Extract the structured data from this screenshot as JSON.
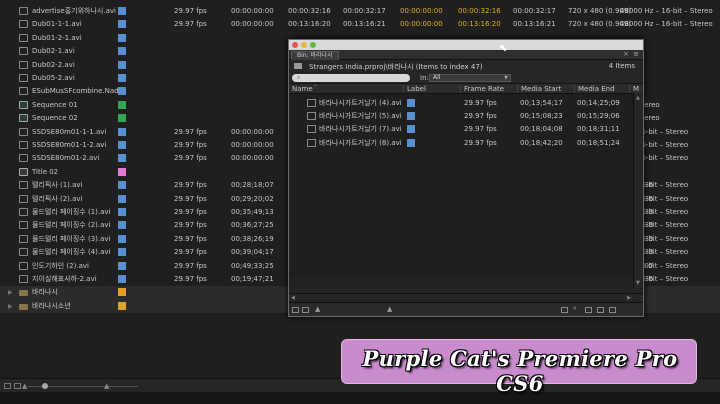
{
  "project": {
    "rows": [
      {
        "type": "clip",
        "name": "advertise홍기위하나시.avi",
        "chip": "#5a8fd0",
        "fps": "29.97 fps",
        "t1": "00:00:00:00",
        "t2": "00:00:32:16",
        "t3": "00:00:32:17",
        "t4": "00:00:00:00",
        "t5": "00:00:32:16",
        "t6": "00:00:32:17",
        "video": "720 x 480 (0.909)",
        "audio": "48000 Hz – 16-bit – Stereo"
      },
      {
        "type": "clip",
        "name": "Dub01-1-1.avi",
        "chip": "#5a8fd0",
        "fps": "29.97 fps",
        "t1": "00:00:00:00",
        "t2": "00:13:16:20",
        "t3": "00:13:16:21",
        "t4": "00:00:00:00",
        "t5": "00:13:16:20",
        "t6": "00:13:16:21",
        "video": "720 x 480 (0.909)",
        "audio": "48000 Hz – 16-bit – Stereo"
      },
      {
        "type": "clip",
        "name": "Dub01-2-1.avi",
        "chip": "#5a8fd0",
        "fps": "",
        "t1": "",
        "t2": "",
        "t3": "",
        "t4": "",
        "t5": "",
        "t6": "",
        "video": "",
        "audio": ""
      },
      {
        "type": "clip",
        "name": "Dub02-1.avi",
        "chip": "#5a8fd0",
        "fps": "",
        "t1": "",
        "t2": "",
        "t3": "",
        "t4": "",
        "t5": "",
        "t6": "",
        "video": "",
        "audio": ""
      },
      {
        "type": "clip",
        "name": "Dub02-2.avi",
        "chip": "#5a8fd0",
        "fps": "",
        "t1": "",
        "t2": "",
        "t3": "",
        "t4": "",
        "t5": "",
        "t6": "",
        "video": "",
        "audio": ""
      },
      {
        "type": "clip",
        "name": "Dub05-2.avi",
        "chip": "#5a8fd0",
        "fps": "",
        "t1": "",
        "t2": "",
        "t3": "",
        "t4": "",
        "t5": "",
        "t6": "",
        "video": "",
        "audio": ""
      },
      {
        "type": "clip",
        "name": "ESubMusSFcombine.Nade",
        "chip": "#5a8fd0",
        "fps": "",
        "t1": "",
        "t2": "",
        "t3": "",
        "t4": "",
        "t5": "",
        "t6": "",
        "video": "",
        "audio": ""
      },
      {
        "type": "seq",
        "name": "Sequence 01",
        "chip": "#2fa84f",
        "fps": "",
        "t1": "",
        "t2": "",
        "t3": "",
        "t4": "",
        "t5": "",
        "t6": "",
        "video": "",
        "audio": "Hz – Stereo"
      },
      {
        "type": "seq",
        "name": "Sequence 02",
        "chip": "#2fa84f",
        "fps": "",
        "t1": "",
        "t2": "",
        "t3": "",
        "t4": "",
        "t5": "",
        "t6": "",
        "video": "",
        "audio": "Hz – Stereo"
      },
      {
        "type": "clip",
        "name": "SSDSE80m01-1-1.avi",
        "chip": "#5a8fd0",
        "fps": "29.97 fps",
        "t1": "00:00:00:00",
        "t2": "",
        "t3": "",
        "t4": "",
        "t5": "",
        "t6": "",
        "video": "",
        "audio": "Hz – 16-bit – Stereo"
      },
      {
        "type": "clip",
        "name": "SSDSE80m01-1-2.avi",
        "chip": "#5a8fd0",
        "fps": "29.97 fps",
        "t1": "00:00:00:00",
        "t2": "",
        "t3": "",
        "t4": "",
        "t5": "",
        "t6": "",
        "video": "",
        "audio": "Hz – 16-bit – Stereo"
      },
      {
        "type": "clip",
        "name": "SSDSE80m01-2.avi",
        "chip": "#5a8fd0",
        "fps": "29.97 fps",
        "t1": "00:00:00:00",
        "t2": "",
        "t3": "",
        "t4": "",
        "t5": "",
        "t6": "",
        "video": "",
        "audio": "Hz – 16-bit – Stereo"
      },
      {
        "type": "title",
        "name": "Title 02",
        "chip": "#e07ad0",
        "fps": "",
        "t1": "",
        "t2": "",
        "t3": "",
        "t4": "",
        "t5": "",
        "t6": "",
        "video": "",
        "audio": ""
      },
      {
        "type": "clip",
        "name": "텔리픽사 (1).avi",
        "chip": "#5a8fd0",
        "fps": "29.97 fps",
        "t1": "00;28;18;07",
        "t2": "",
        "t3": "",
        "t4": "",
        "t5": "",
        "t6": "",
        "video": "",
        "audio": "Hz – 16-bit – Stereo",
        "more": "036"
      },
      {
        "type": "clip",
        "name": "텔리픽사 (2).avi",
        "chip": "#5a8fd0",
        "fps": "29.97 fps",
        "t1": "00;29;20;02",
        "t2": "",
        "t3": "",
        "t4": "",
        "t5": "",
        "t6": "",
        "video": "",
        "audio": "Hz – 16-bit – Stereo",
        "more": "036"
      },
      {
        "type": "clip",
        "name": "물드텔리 페이징수 (1).avi",
        "chip": "#5a8fd0",
        "fps": "29.97 fps",
        "t1": "00;35;49;13",
        "t2": "",
        "t3": "",
        "t4": "",
        "t5": "",
        "t6": "",
        "video": "",
        "audio": "Hz – 16-bit – Stereo",
        "more": "033"
      },
      {
        "type": "clip",
        "name": "물드텔리 페이징수 (2).avi",
        "chip": "#5a8fd0",
        "fps": "29.97 fps",
        "t1": "00;36;27;25",
        "t2": "",
        "t3": "",
        "t4": "",
        "t5": "",
        "t6": "",
        "video": "",
        "audio": "Hz – 16-bit – Stereo",
        "more": "033"
      },
      {
        "type": "clip",
        "name": "물드텔리 페이징수 (3).avi",
        "chip": "#5a8fd0",
        "fps": "29.97 fps",
        "t1": "00;38;26;19",
        "t2": "",
        "t3": "",
        "t4": "",
        "t5": "",
        "t6": "",
        "video": "",
        "audio": "Hz – 16-bit – Stereo",
        "more": "033"
      },
      {
        "type": "clip",
        "name": "물드텔리 페이징수 (4).avi",
        "chip": "#5a8fd0",
        "fps": "29.97 fps",
        "t1": "00;39;04;17",
        "t2": "",
        "t3": "",
        "t4": "",
        "t5": "",
        "t6": "",
        "video": "",
        "audio": "Hz – 16-bit – Stereo",
        "more": "033"
      },
      {
        "type": "clip",
        "name": "인도기하인 (2).avi",
        "chip": "#5a8fd0",
        "fps": "29.97 fps",
        "t1": "00;49;33;25",
        "t2": "",
        "t3": "",
        "t4": "",
        "t5": "",
        "t6": "",
        "video": "",
        "audio": "Hz – 16-bit – Stereo",
        "more": "007"
      },
      {
        "type": "clip",
        "name": "지이실해표사하-2.avi",
        "chip": "#5a8fd0",
        "fps": "29.97 fps",
        "t1": "00;19;47;21",
        "t2": "",
        "t3": "",
        "t4": "",
        "t5": "",
        "t6": "",
        "video": "",
        "audio": "Hz – 16-bit – Stereo",
        "more": "036"
      },
      {
        "type": "bin",
        "name": "바라나시",
        "chip": "#e0a030",
        "fps": "",
        "t1": "",
        "t2": "",
        "t3": "",
        "t4": "",
        "t5": "",
        "t6": "",
        "video": "",
        "audio": ""
      },
      {
        "type": "bin",
        "name": "바라나시소년",
        "chip": "#e0a030",
        "fps": "",
        "t1": "",
        "t2": "",
        "t3": "",
        "t4": "",
        "t5": "",
        "t6": "",
        "video": "",
        "audio": ""
      }
    ]
  },
  "bin": {
    "tab_label": "Bin: 바라나시",
    "path": "Strangers India.prproj\\바라나시  (Items to index 47)",
    "item_count": "4 Items",
    "in_label": "In:",
    "in_value": "All",
    "columns": {
      "name": "Name",
      "label": "Label",
      "frame_rate": "Frame Rate",
      "media_start": "Media Start",
      "media_end": "Media End",
      "more": "Med"
    },
    "rows": [
      {
        "name": "바라나시가트거닐기 (4).avi",
        "fps": "29.97 fps",
        "start": "00;13;54;17",
        "end": "00;14;25;09"
      },
      {
        "name": "바라나시가트거닐기 (5).avi",
        "fps": "29.97 fps",
        "start": "00;15;08;23",
        "end": "00;15;29;06"
      },
      {
        "name": "바라나시가트거닐기 (7).avi",
        "fps": "29.97 fps",
        "start": "00;18;04;08",
        "end": "00;18;31;11"
      },
      {
        "name": "바라나시가트거닐기 (8).avi",
        "fps": "29.97 fps",
        "start": "00;18;42;20",
        "end": "00;18;51;24"
      }
    ]
  },
  "watermark": {
    "text": "Purple Cat's Premiere Pro CS6"
  },
  "colors": {
    "timecode_accent": "#e0b020",
    "badge_bg": "#c88ccc"
  }
}
